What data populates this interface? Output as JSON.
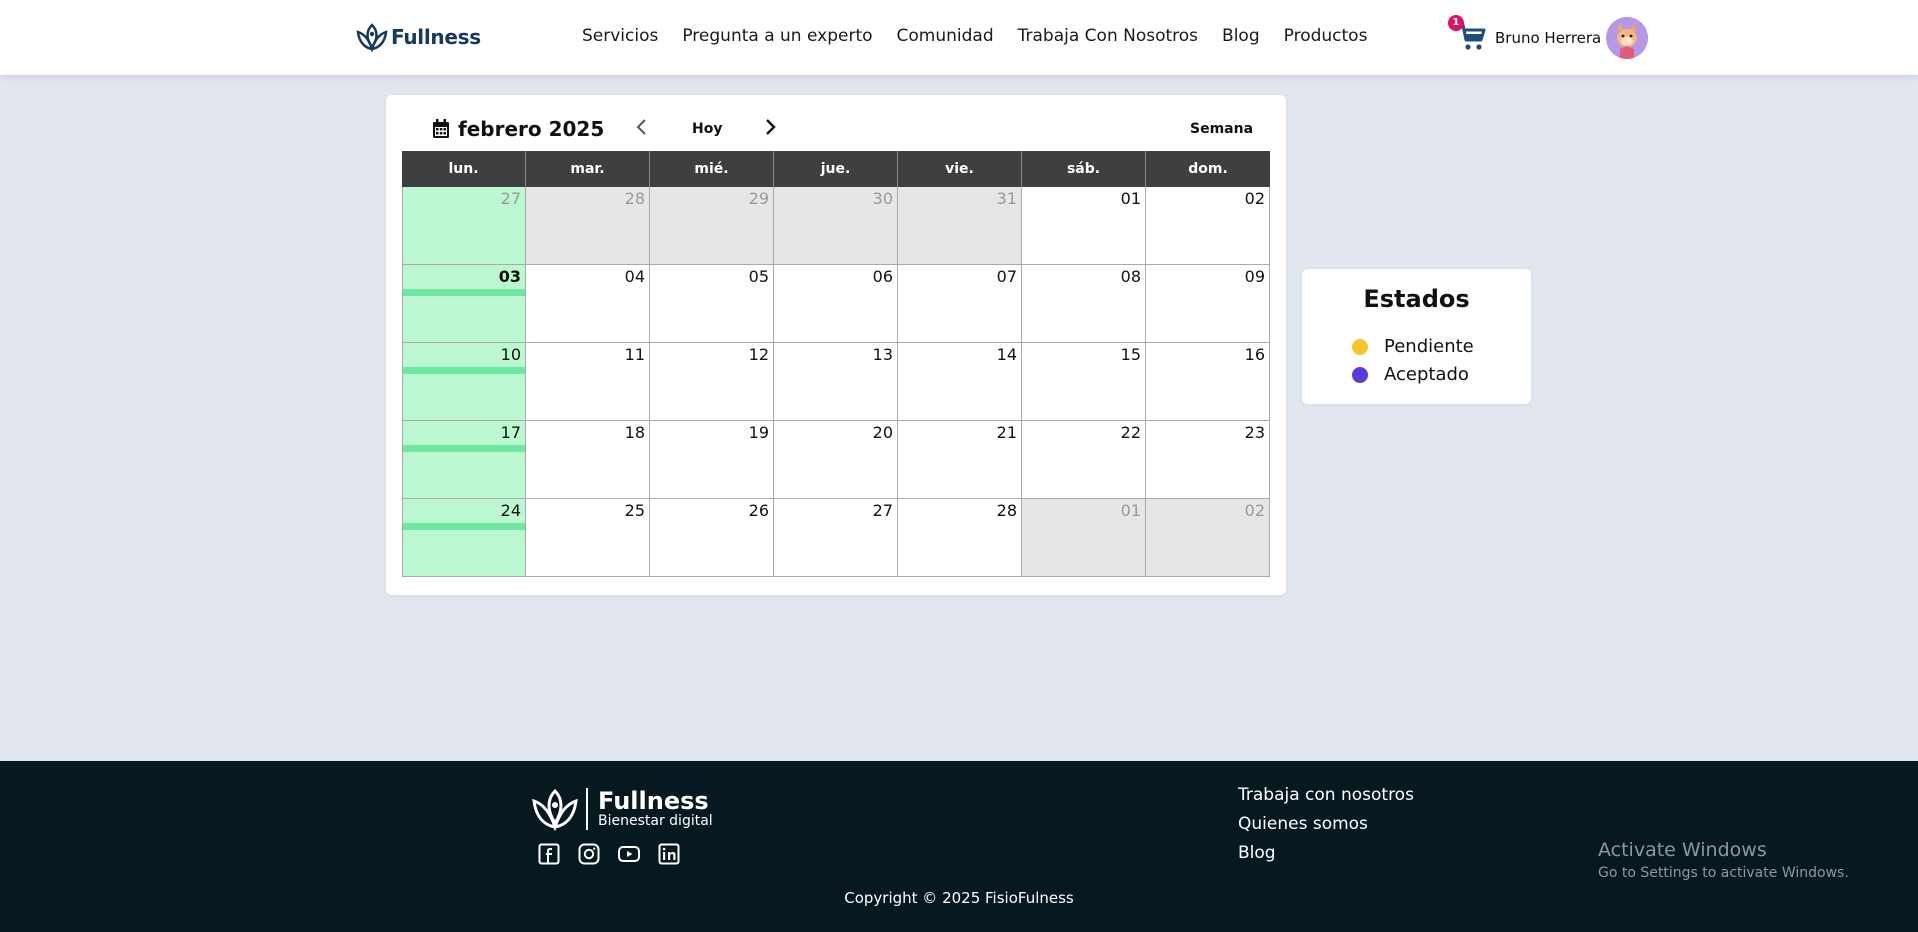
{
  "header": {
    "logo_text": "Fullness",
    "nav": [
      "Servicios",
      "Pregunta a un experto",
      "Comunidad",
      "Trabaja Con Nosotros",
      "Blog",
      "Productos"
    ],
    "cart_count": "1",
    "user_name": "Bruno Herrera"
  },
  "calendar": {
    "title": "febrero 2025",
    "today_label": "Hoy",
    "view_label": "Semana",
    "weekdays": [
      "lun.",
      "mar.",
      "mié.",
      "jue.",
      "vie.",
      "sáb.",
      "dom."
    ],
    "weeks": [
      [
        {
          "n": "27",
          "other": true,
          "green": true
        },
        {
          "n": "28",
          "other": true
        },
        {
          "n": "29",
          "other": true
        },
        {
          "n": "30",
          "other": true
        },
        {
          "n": "31",
          "other": true
        },
        {
          "n": "01"
        },
        {
          "n": "02"
        }
      ],
      [
        {
          "n": "03",
          "green": true,
          "today": true,
          "bar": true
        },
        {
          "n": "04"
        },
        {
          "n": "05"
        },
        {
          "n": "06"
        },
        {
          "n": "07"
        },
        {
          "n": "08"
        },
        {
          "n": "09"
        }
      ],
      [
        {
          "n": "10",
          "green": true,
          "bar": true
        },
        {
          "n": "11"
        },
        {
          "n": "12"
        },
        {
          "n": "13"
        },
        {
          "n": "14"
        },
        {
          "n": "15"
        },
        {
          "n": "16"
        }
      ],
      [
        {
          "n": "17",
          "green": true,
          "bar": true
        },
        {
          "n": "18"
        },
        {
          "n": "19"
        },
        {
          "n": "20"
        },
        {
          "n": "21"
        },
        {
          "n": "22"
        },
        {
          "n": "23"
        }
      ],
      [
        {
          "n": "24",
          "green": true,
          "bar": true
        },
        {
          "n": "25"
        },
        {
          "n": "26"
        },
        {
          "n": "27"
        },
        {
          "n": "28"
        },
        {
          "n": "01",
          "other": true
        },
        {
          "n": "02",
          "other": true
        }
      ]
    ]
  },
  "estados": {
    "title": "Estados",
    "items": [
      {
        "label": "Pendiente",
        "color": "#f7c72a"
      },
      {
        "label": "Aceptado",
        "color": "#5b3cdb"
      }
    ]
  },
  "footer": {
    "brand": "Fullness",
    "tagline": "Bienestar digital",
    "socials": [
      "facebook-icon",
      "instagram-icon",
      "youtube-icon",
      "linkedin-icon"
    ],
    "links": [
      "Trabaja con nosotros",
      "Quienes somos",
      "Blog"
    ],
    "copyright": "Copyright © 2025 FisioFulness"
  },
  "watermark": {
    "title": "Activate Windows",
    "subtitle": "Go to Settings to activate Windows."
  },
  "colors": {
    "accent_dark": "#123a5e",
    "footer_bg": "#061921",
    "green_cell": "#bbf7d0",
    "green_bar": "#6ee7a0"
  }
}
